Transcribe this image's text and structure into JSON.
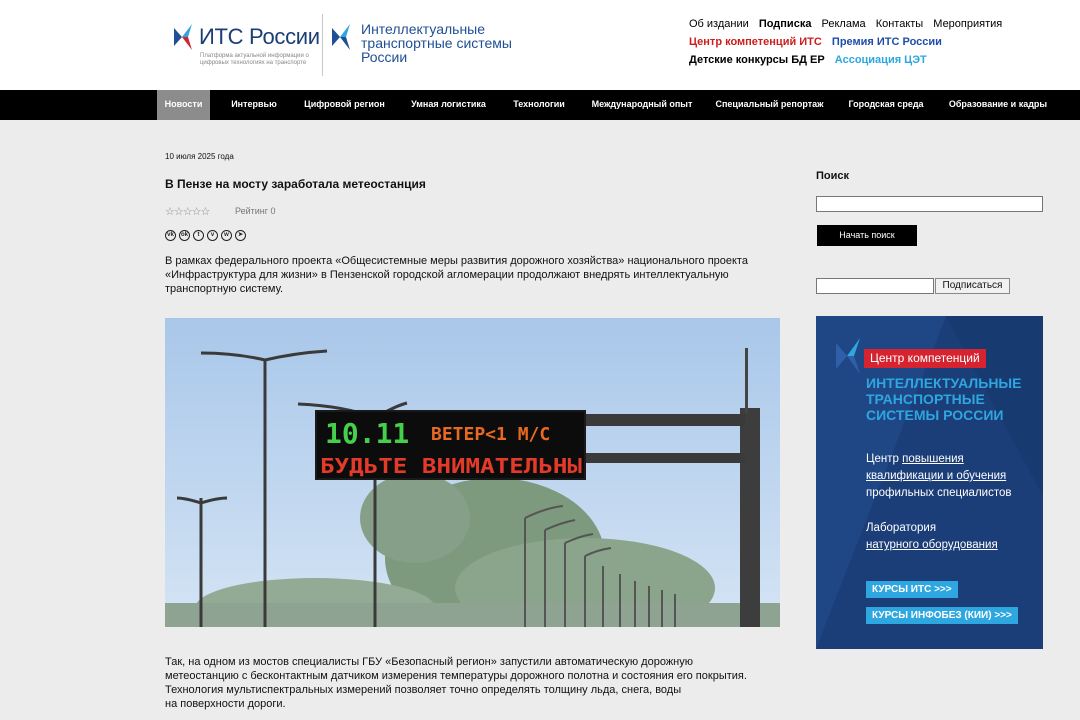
{
  "header": {
    "logo_its": {
      "name": "ИТС России",
      "tagline": "Платформа актуальной информации о цифровых технологиях на транспорте"
    },
    "logo_its2": {
      "text": "Интеллектуальные транспортные системы России"
    },
    "links_row1": [
      "Об издании",
      "Подписка",
      "Реклама",
      "Контакты",
      "Мероприятия"
    ],
    "links_row2": [
      "Центр компетенций ИТС",
      "Премия ИТС России"
    ],
    "links_row3": [
      "Детские конкурсы БД ЕР",
      "Ассоциация ЦЭТ"
    ]
  },
  "nav": {
    "items": [
      "Новости",
      "Интервью",
      "Цифровой регион",
      "Умная логистика",
      "Технологии",
      "Международный опыт",
      "Специальный репортаж",
      "Городская среда",
      "Образование и кадры"
    ],
    "active": "Новости"
  },
  "article": {
    "date": "10 июля 2025 года",
    "title": "В Пензе на мосту заработала метеостанция",
    "rating_label": "Рейтинг 0",
    "rating_value": 0,
    "rating_max": 5,
    "share_icons": [
      "vk-icon",
      "ok-icon",
      "twitter-icon",
      "viber-icon",
      "whatsapp-icon",
      "telegram-icon"
    ],
    "lead": "В рамках федерального проекта «Общесистемные меры развития дорожного хозяйства» национального проекта «Инфраструктура для жизни» в Пензенской городской агломерации продолжают внедрять интеллектуальную транспортную систему.",
    "photo": {
      "sign_time": "10.11",
      "sign_wind": "ВЕТЕР<1 М/С",
      "sign_warning": "БУДЬТЕ ВНИМАТЕЛЬНЫ"
    },
    "body_lines": [
      "Так, на одном из мостов специалисты ГБУ «Безопасный регион» запустили автоматическую дорожную",
      "метеостанцию с бесконтактным датчиком измерения температуры дорожного полотна и состояния его покрытия.",
      "Технология мультиспектральных измерений позволяет точно определять толщину льда, снега, воды",
      "на поверхности дороги."
    ]
  },
  "sidebar": {
    "search_label": "Поиск",
    "search_value": "",
    "search_button": "Начать поиск",
    "subscribe_value": "",
    "subscribe_button": "Подписаться",
    "banner": {
      "head": "Центр компетенций",
      "title_lines": [
        "ИНТЕЛЛЕКТУАЛЬНЫЕ",
        "ТРАНСПОРТНЫЕ",
        "СИСТЕМЫ РОССИИ"
      ],
      "line1": "Центр ",
      "line1_u": "повышения",
      "line2_u": "квалификации и обучения",
      "line3": "профильных специалистов",
      "line4": "Лаборатория",
      "line5_u": "натурного оборудования",
      "btn1": "КУРСЫ ИТС >>>",
      "btn2": "КУРСЫ ИНФОБЕЗ (КИИ) >>>"
    }
  },
  "colors": {
    "nav_bg": "#000000",
    "nav_active": "#8c8c8c",
    "brand_blue": "#1b3d78",
    "accent_red": "#cc1e1e",
    "accent_light_blue": "#2ea6e0"
  }
}
